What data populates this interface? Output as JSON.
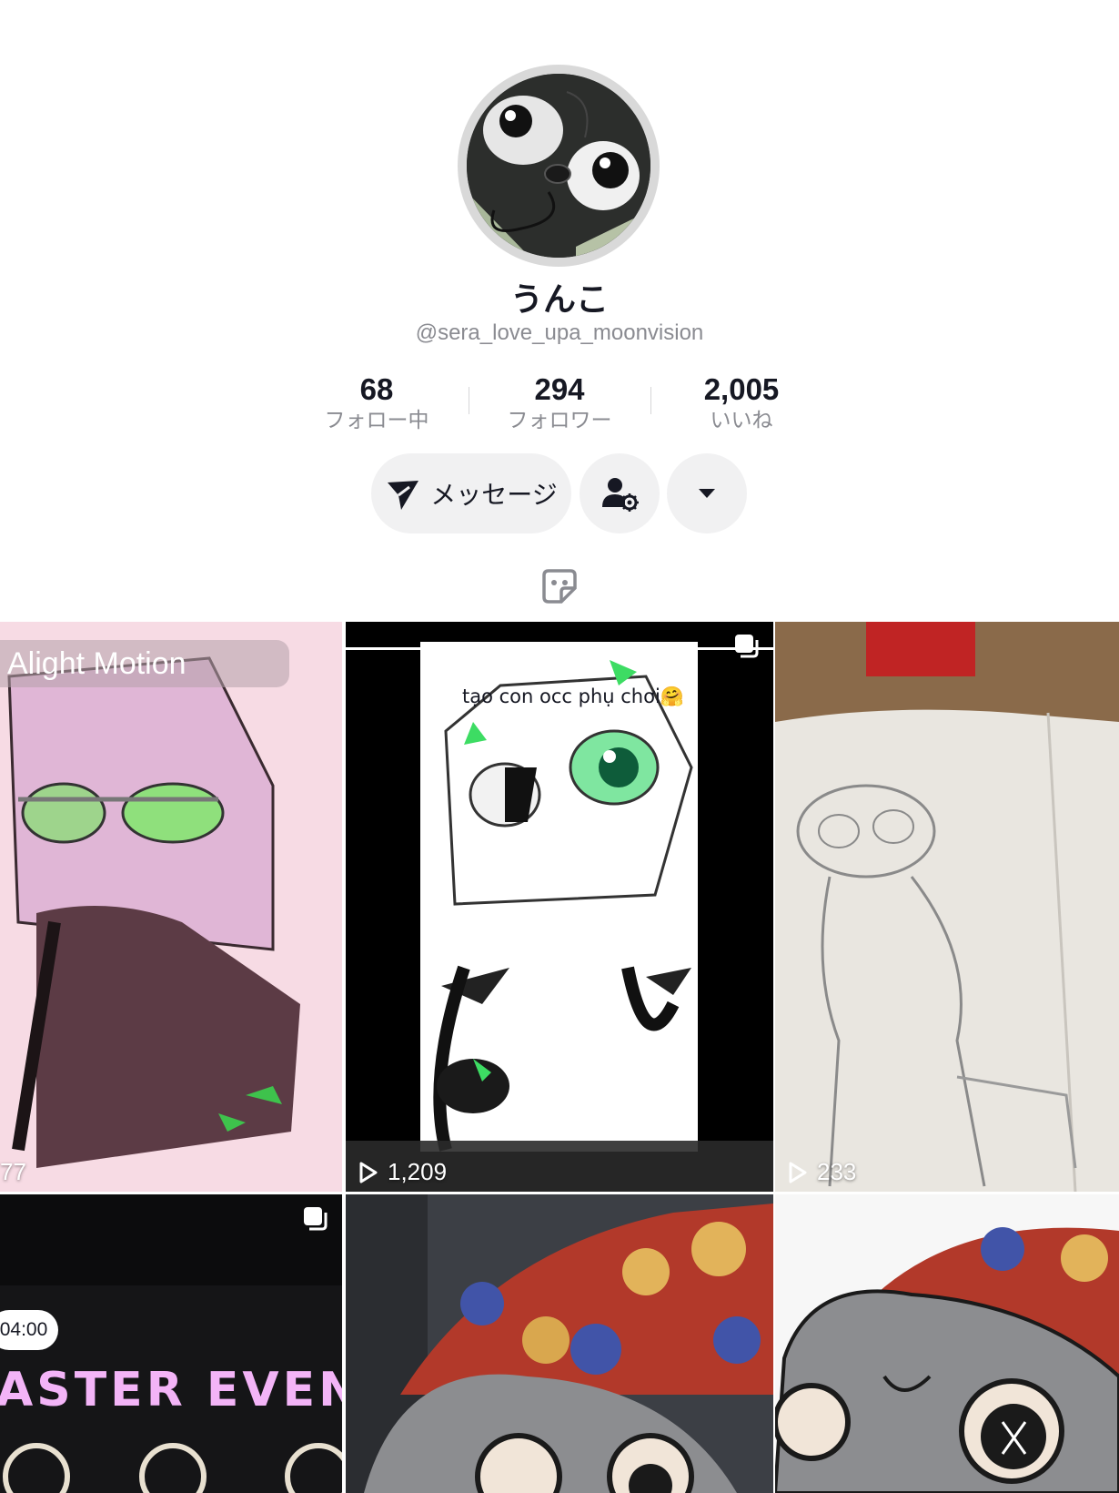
{
  "profile": {
    "display_name": "うんこ",
    "username": "@sera_love_upa_moonvision"
  },
  "stats": [
    {
      "value": "68",
      "label": "フォロー中"
    },
    {
      "value": "294",
      "label": "フォロワー"
    },
    {
      "value": "2,005",
      "label": "いいね"
    }
  ],
  "actions": {
    "message_label": "メッセージ",
    "icons": [
      "send-icon",
      "user-settings-icon",
      "caret-down-icon"
    ]
  },
  "tab_icon": "sticker-icon",
  "videos": [
    {
      "caption": "Alight Motion",
      "views": "77"
    },
    {
      "caption": "tạo con occ phụ chơi🤗",
      "views": "1,209"
    },
    {
      "caption": "",
      "views": "233"
    },
    {
      "timer": "04:00",
      "caption": "ASTER EVEN",
      "views": ""
    },
    {
      "caption": "",
      "views": ""
    },
    {
      "caption": "",
      "views": ""
    }
  ],
  "colors": {
    "background": "#ffffff",
    "text_primary": "#161823",
    "text_secondary": "#8a8b91",
    "button_bg": "#f1f1f2"
  }
}
